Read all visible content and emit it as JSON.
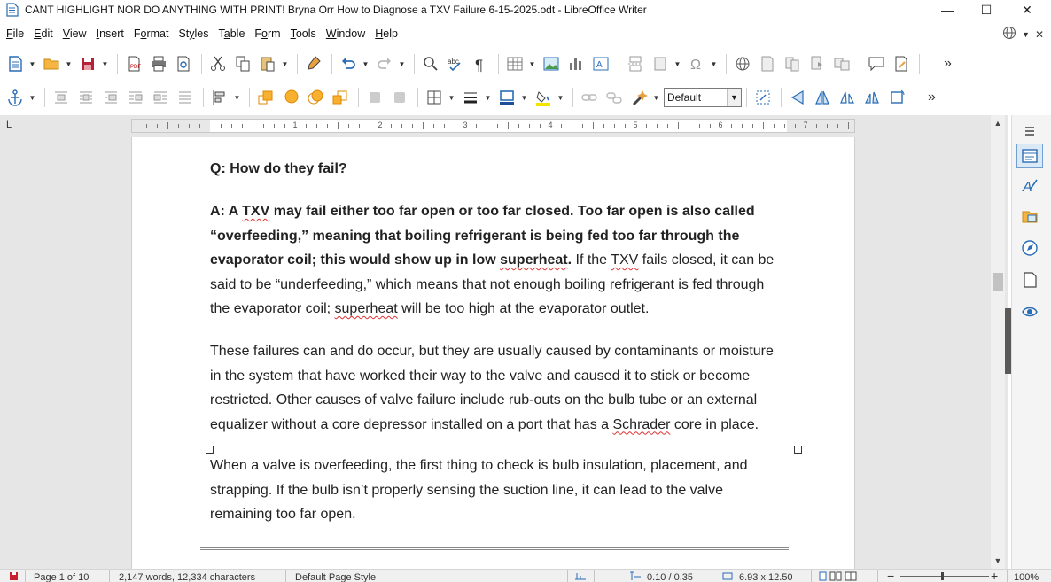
{
  "window": {
    "title": "CANT HIGHLIGHT NOR DO ANYTHING WITH PRINT! Bryna Orr How to Diagnose a TXV Failure  6-15-2025.odt - LibreOffice Writer",
    "minimize": "—",
    "maximize": "☐",
    "close": "✕"
  },
  "menu": [
    {
      "label": "File",
      "accel": "F",
      "rest": "ile"
    },
    {
      "label": "Edit",
      "accel": "E",
      "rest": "dit"
    },
    {
      "label": "View",
      "accel": "V",
      "rest": "iew"
    },
    {
      "label": "Insert",
      "accel": "I",
      "rest": "nsert"
    },
    {
      "label": "Format",
      "accel": "F",
      "rest": "ormat",
      "accel_pos": "first"
    },
    {
      "label": "Styles",
      "accel": "S",
      "rest": "tyles"
    },
    {
      "label": "Table",
      "accel": "T",
      "rest": "able"
    },
    {
      "label": "Form",
      "accel": "F",
      "rest": "orm"
    },
    {
      "label": "Tools",
      "accel": "T",
      "rest": "ools"
    },
    {
      "label": "Window",
      "accel": "W",
      "rest": "indow"
    },
    {
      "label": "Help",
      "accel": "H",
      "rest": "elp"
    }
  ],
  "menu_close": "✕",
  "toolbar": {
    "paragraph_style": "Default",
    "overflow": "»"
  },
  "ruler": {
    "numbers": [
      "1",
      "2",
      "3",
      "4",
      "5",
      "6",
      "7"
    ],
    "corner": "L"
  },
  "document": {
    "question": "Q: How do they fail?",
    "answer": {
      "bold_parts": [
        "A: A ",
        "TXV",
        " may fail either too far open or too far closed. Too far open is also called “overfeeding,” meaning that boiling refrigerant is being fed too far through the evaporator coil; this would show up in low ",
        "superheat",
        "."
      ],
      "normal_parts": [
        " If the ",
        "TXV",
        " fails closed, it can be said to be “underfeeding,” which means that not enough boiling refrigerant is fed through the evaporator coil; ",
        "superheat",
        " will be too high at the evaporator outlet."
      ]
    },
    "paragraph2": [
      "These failures can and do occur, but they are usually caused by contaminants or moisture in the system that have worked their way to the valve and caused it to stick or become restricted. Other causes of valve failure include rub-outs on the bulb tube or an external equalizer without a core depressor installed on a port that has a ",
      "Schrader",
      " core in place."
    ],
    "paragraph3": "When a valve is overfeeding, the first thing to check is bulb insulation, placement, and strapping. If the bulb isn’t properly sensing the suction line, it can lead to the valve remaining too far open."
  },
  "statusbar": {
    "page": "Page 1 of 10",
    "words": "2,147 words, 12,334 characters",
    "page_style": "Default Page Style",
    "position": "0.10 / 0.35",
    "size": "6.93 x 12.50",
    "zoom": "100%"
  },
  "colors": {
    "accent": "#2a6db5",
    "spell_error": "#e03030"
  }
}
